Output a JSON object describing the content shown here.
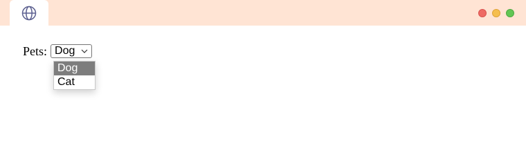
{
  "window": {
    "colors": {
      "titlebar": "#ffe4d4",
      "close": "#ee6a64",
      "minimize": "#f5be4f",
      "maximize": "#62c654"
    },
    "tab_icon": "globe-icon"
  },
  "form": {
    "label": "Pets:",
    "select": {
      "value": "Dog",
      "options": [
        "Dog",
        "Cat"
      ],
      "highlighted_option": "Dog"
    }
  }
}
